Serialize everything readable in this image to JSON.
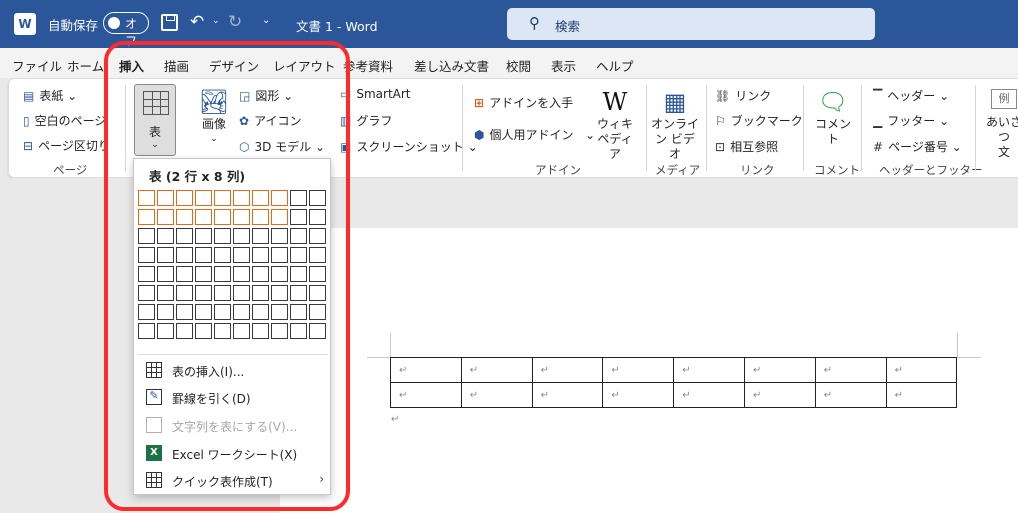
{
  "titlebar": {
    "logo": "W",
    "autosave_label": "自動保存",
    "autosave_state": "オフ",
    "qat_more": "⌄",
    "doc_title": "文書 1  -  Word",
    "search_placeholder": "検索"
  },
  "tabs": [
    "ファイル",
    "ホーム",
    "挿入",
    "描画",
    "デザイン",
    "レイアウト",
    "参考資料",
    "差し込み文書",
    "校閲",
    "表示",
    "ヘルプ"
  ],
  "active_tab": "挿入",
  "ribbon": {
    "pages": {
      "cover": "表紙",
      "blank": "空白のページ",
      "page_break": "ページ区切り",
      "label": "ページ"
    },
    "table": {
      "label": "表"
    },
    "illustrations": {
      "picture": "画像",
      "shapes": "図形",
      "icons": "アイコン",
      "models3d": "3D モデル",
      "smartart": "SmartArt",
      "chart": "グラフ",
      "screenshot": "スクリーンショット"
    },
    "addins": {
      "get": "アドインを入手",
      "my": "個人用アドイン",
      "wiki": "ウィキ\nペディア",
      "label": "アドイン"
    },
    "media": {
      "video": "オンライ\nン ビデオ",
      "label": "メディア"
    },
    "links": {
      "link": "リンク",
      "bookmark": "ブックマーク",
      "crossref": "相互参照",
      "label": "リンク"
    },
    "comments": {
      "comment": "コメント",
      "label": "コメント"
    },
    "header_footer": {
      "header": "ヘッダー",
      "footer": "フッター",
      "page_number": "ページ番号",
      "label": "ヘッダーとフッター"
    },
    "text": {
      "example": "例",
      "greeting": "あいさつ\n文"
    }
  },
  "dropdown": {
    "title": "表 (2 行 x 8 列)",
    "grid_cols": 10,
    "grid_rows": 8,
    "selected_cols": 8,
    "selected_rows": 2,
    "items": [
      {
        "label": "表の挿入(I)...",
        "icon": "table-icon",
        "disabled": false
      },
      {
        "label": "罫線を引く(D)",
        "icon": "draw-table-icon",
        "disabled": false
      },
      {
        "label": "文字列を表にする(V)...",
        "icon": "convert-text-icon",
        "disabled": true
      },
      {
        "label": "Excel ワークシート(X)",
        "icon": "excel-icon",
        "disabled": false
      },
      {
        "label": "クイック表作成(T)",
        "icon": "table-icon",
        "disabled": false,
        "submenu": true
      }
    ]
  },
  "document": {
    "table_rows": 2,
    "table_cols": 8,
    "cell_mark": "↵",
    "para_mark": "↵"
  },
  "colors": {
    "titlebar": "#2b579a",
    "grid_selected": "#e26a1d",
    "highlight": "#ff2a2a"
  }
}
